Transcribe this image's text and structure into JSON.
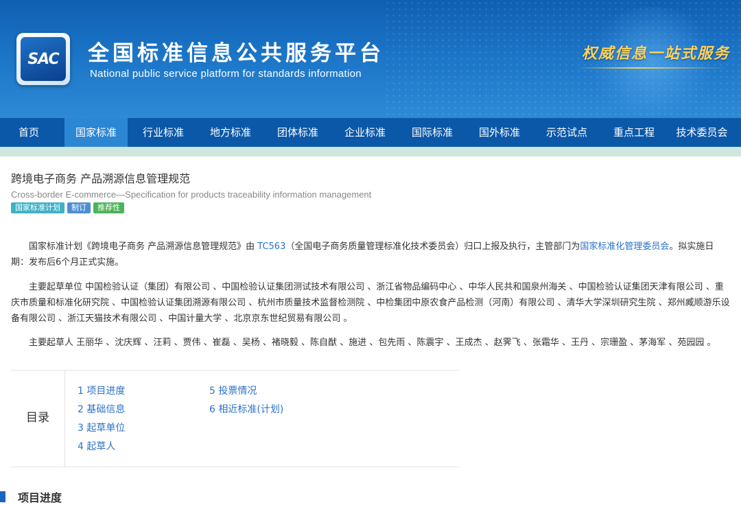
{
  "header": {
    "logo_text": "SAC",
    "title_cn": "全国标准信息公共服务平台",
    "title_en": "National public service platform  for standards information",
    "slogan": "权威信息一站式服务"
  },
  "nav": {
    "items": [
      {
        "label": "首页",
        "active": false
      },
      {
        "label": "国家标准",
        "active": true
      },
      {
        "label": "行业标准",
        "active": false
      },
      {
        "label": "地方标准",
        "active": false
      },
      {
        "label": "团体标准",
        "active": false
      },
      {
        "label": "企业标准",
        "active": false
      },
      {
        "label": "国际标准",
        "active": false
      },
      {
        "label": "国外标准",
        "active": false
      },
      {
        "label": "示范试点",
        "active": false
      },
      {
        "label": "重点工程",
        "active": false
      },
      {
        "label": "技术委员会",
        "active": false
      }
    ]
  },
  "doc": {
    "title_cn": "跨境电子商务 产品溯源信息管理规范",
    "title_en": "Cross-border E-commerce—Specification for products traceability information management",
    "tags": [
      "国家标准计划",
      "制订",
      "推荐性"
    ],
    "p1": {
      "prefix": "国家标准计划《跨境电子商务 产品溯源信息管理规范》由 ",
      "tc_link": "TC563",
      "middle": "（全国电子商务质量管理标准化技术委员会）归口上报及执行，主管部门为",
      "dept_link": "国家标准化管理委员会",
      "suffix": "。拟实施日期：发布后6个月正式实施。"
    },
    "p2": "主要起草单位 中国检验认证（集团）有限公司 、中国检验认证集团测试技术有限公司 、浙江省物品编码中心 、中华人民共和国泉州海关 、中国检验认证集团天津有限公司 、重庆市质量和标准化研究院 、中国检验认证集团溯源有限公司 、杭州市质量技术监督检测院 、中检集团中原农食产品检测（河南）有限公司 、清华大学深圳研究生院 、郑州臧顺游乐设备有限公司 、浙江天猫技术有限公司 、中国计量大学 、北京京东世纪贸易有限公司 。",
    "p3": "主要起草人 王丽华 、沈庆辉 、汪莉 、贾伟 、崔磊 、吴杨 、褚晓毅 、陈自猷 、施进 、包先雨 、陈震宇 、王成杰 、赵霁飞 、张霜华 、王丹 、宗珊盈 、茅海军 、苑园园 。"
  },
  "toc": {
    "label": "目录",
    "items": [
      "1  项目进度",
      "2  基础信息",
      "3  起草单位",
      "4  起草人",
      "5  投票情况",
      "6  相近标准(计划)"
    ]
  },
  "section": {
    "title": "项目进度"
  },
  "colors": {
    "nav_bg": "#0c58a8",
    "nav_active": "#2b86d4",
    "link": "#2b72c8",
    "strip": "#cfe6df"
  }
}
